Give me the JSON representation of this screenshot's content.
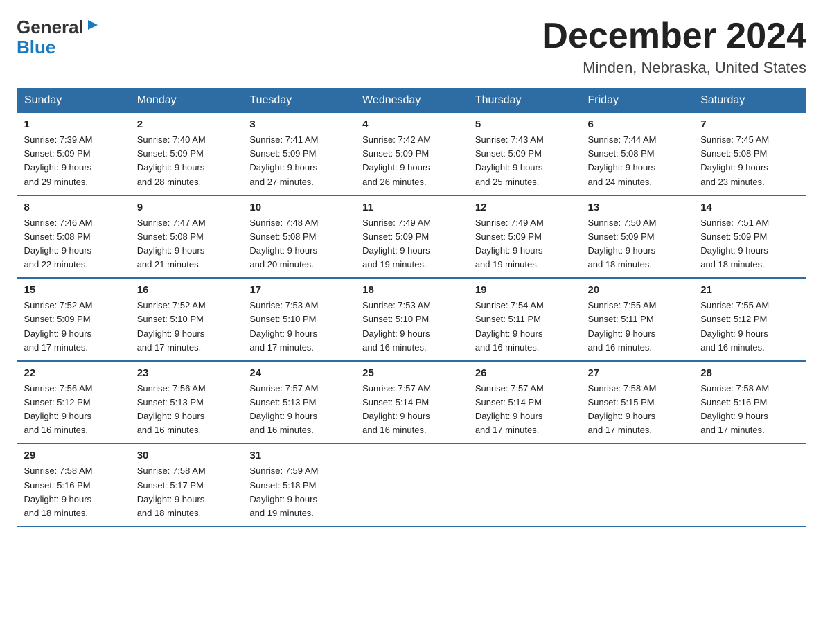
{
  "header": {
    "logo_general": "General",
    "logo_blue": "Blue",
    "main_title": "December 2024",
    "subtitle": "Minden, Nebraska, United States"
  },
  "calendar": {
    "days_of_week": [
      "Sunday",
      "Monday",
      "Tuesday",
      "Wednesday",
      "Thursday",
      "Friday",
      "Saturday"
    ],
    "weeks": [
      [
        {
          "num": "1",
          "sunrise": "7:39 AM",
          "sunset": "5:09 PM",
          "daylight": "9 hours and 29 minutes."
        },
        {
          "num": "2",
          "sunrise": "7:40 AM",
          "sunset": "5:09 PM",
          "daylight": "9 hours and 28 minutes."
        },
        {
          "num": "3",
          "sunrise": "7:41 AM",
          "sunset": "5:09 PM",
          "daylight": "9 hours and 27 minutes."
        },
        {
          "num": "4",
          "sunrise": "7:42 AM",
          "sunset": "5:09 PM",
          "daylight": "9 hours and 26 minutes."
        },
        {
          "num": "5",
          "sunrise": "7:43 AM",
          "sunset": "5:09 PM",
          "daylight": "9 hours and 25 minutes."
        },
        {
          "num": "6",
          "sunrise": "7:44 AM",
          "sunset": "5:08 PM",
          "daylight": "9 hours and 24 minutes."
        },
        {
          "num": "7",
          "sunrise": "7:45 AM",
          "sunset": "5:08 PM",
          "daylight": "9 hours and 23 minutes."
        }
      ],
      [
        {
          "num": "8",
          "sunrise": "7:46 AM",
          "sunset": "5:08 PM",
          "daylight": "9 hours and 22 minutes."
        },
        {
          "num": "9",
          "sunrise": "7:47 AM",
          "sunset": "5:08 PM",
          "daylight": "9 hours and 21 minutes."
        },
        {
          "num": "10",
          "sunrise": "7:48 AM",
          "sunset": "5:08 PM",
          "daylight": "9 hours and 20 minutes."
        },
        {
          "num": "11",
          "sunrise": "7:49 AM",
          "sunset": "5:09 PM",
          "daylight": "9 hours and 19 minutes."
        },
        {
          "num": "12",
          "sunrise": "7:49 AM",
          "sunset": "5:09 PM",
          "daylight": "9 hours and 19 minutes."
        },
        {
          "num": "13",
          "sunrise": "7:50 AM",
          "sunset": "5:09 PM",
          "daylight": "9 hours and 18 minutes."
        },
        {
          "num": "14",
          "sunrise": "7:51 AM",
          "sunset": "5:09 PM",
          "daylight": "9 hours and 18 minutes."
        }
      ],
      [
        {
          "num": "15",
          "sunrise": "7:52 AM",
          "sunset": "5:09 PM",
          "daylight": "9 hours and 17 minutes."
        },
        {
          "num": "16",
          "sunrise": "7:52 AM",
          "sunset": "5:10 PM",
          "daylight": "9 hours and 17 minutes."
        },
        {
          "num": "17",
          "sunrise": "7:53 AM",
          "sunset": "5:10 PM",
          "daylight": "9 hours and 17 minutes."
        },
        {
          "num": "18",
          "sunrise": "7:53 AM",
          "sunset": "5:10 PM",
          "daylight": "9 hours and 16 minutes."
        },
        {
          "num": "19",
          "sunrise": "7:54 AM",
          "sunset": "5:11 PM",
          "daylight": "9 hours and 16 minutes."
        },
        {
          "num": "20",
          "sunrise": "7:55 AM",
          "sunset": "5:11 PM",
          "daylight": "9 hours and 16 minutes."
        },
        {
          "num": "21",
          "sunrise": "7:55 AM",
          "sunset": "5:12 PM",
          "daylight": "9 hours and 16 minutes."
        }
      ],
      [
        {
          "num": "22",
          "sunrise": "7:56 AM",
          "sunset": "5:12 PM",
          "daylight": "9 hours and 16 minutes."
        },
        {
          "num": "23",
          "sunrise": "7:56 AM",
          "sunset": "5:13 PM",
          "daylight": "9 hours and 16 minutes."
        },
        {
          "num": "24",
          "sunrise": "7:57 AM",
          "sunset": "5:13 PM",
          "daylight": "9 hours and 16 minutes."
        },
        {
          "num": "25",
          "sunrise": "7:57 AM",
          "sunset": "5:14 PM",
          "daylight": "9 hours and 16 minutes."
        },
        {
          "num": "26",
          "sunrise": "7:57 AM",
          "sunset": "5:14 PM",
          "daylight": "9 hours and 17 minutes."
        },
        {
          "num": "27",
          "sunrise": "7:58 AM",
          "sunset": "5:15 PM",
          "daylight": "9 hours and 17 minutes."
        },
        {
          "num": "28",
          "sunrise": "7:58 AM",
          "sunset": "5:16 PM",
          "daylight": "9 hours and 17 minutes."
        }
      ],
      [
        {
          "num": "29",
          "sunrise": "7:58 AM",
          "sunset": "5:16 PM",
          "daylight": "9 hours and 18 minutes."
        },
        {
          "num": "30",
          "sunrise": "7:58 AM",
          "sunset": "5:17 PM",
          "daylight": "9 hours and 18 minutes."
        },
        {
          "num": "31",
          "sunrise": "7:59 AM",
          "sunset": "5:18 PM",
          "daylight": "9 hours and 19 minutes."
        },
        null,
        null,
        null,
        null
      ]
    ]
  }
}
